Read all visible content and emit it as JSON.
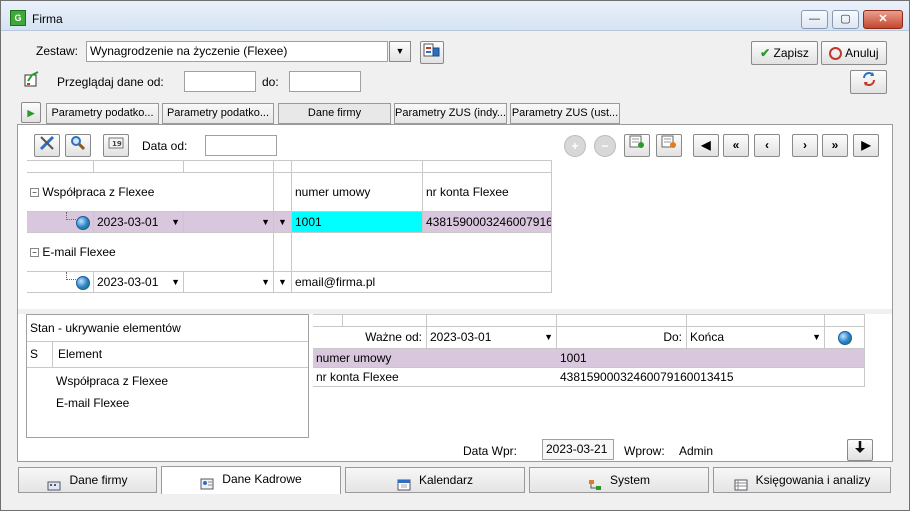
{
  "window": {
    "title": "Firma",
    "min": "—",
    "max": "▢",
    "close": "✕"
  },
  "toolbar": {
    "zestaw_label": "Zestaw:",
    "zestaw_value": "Wynagrodzenie na życzenie (Flexee)",
    "save_label": "Zapisz",
    "cancel_label": "Anuluj",
    "przegladaj_label": "Przeglądaj dane od:",
    "przegladaj_from": "",
    "do_label": "do:",
    "przegladaj_to": ""
  },
  "tabs": [
    "Parametry podatko...",
    "Parametry podatko...",
    "Dane firmy",
    "Parametry ZUS (indy...",
    "Parametry ZUS (ust..."
  ],
  "panel": {
    "data_od_label": "Data od:",
    "data_od_value": "",
    "groups": [
      {
        "name": "Współpraca z Flexee",
        "col_headers": [
          "numer umowy",
          "nr konta Flexee"
        ],
        "date": "2023-03-01",
        "values": [
          "1001",
          "4381590003246007916..."
        ]
      },
      {
        "name": "E-mail Flexee",
        "date": "2023-03-01",
        "values": [
          "email@firma.pl"
        ]
      }
    ],
    "stan": {
      "title": "Stan - ukrywanie elementów",
      "col_s": "S",
      "col_element": "Element",
      "items": [
        "Współpraca z Flexee",
        "E-mail Flexee"
      ]
    },
    "detail": {
      "wazne_od_label": "Ważne od:",
      "wazne_od_value": "2023-03-01",
      "do_label": "Do:",
      "do_value": "Końca",
      "rows": [
        {
          "label": "numer umowy",
          "value": "1001"
        },
        {
          "label": "nr konta Flexee",
          "value": "43815900032460079160013415"
        }
      ]
    },
    "footer": {
      "data_wpr_label": "Data Wpr:",
      "data_wpr_value": "2023-03-21",
      "wprow_label": "Wprow:",
      "wprow_value": "Admin"
    }
  },
  "bottom_tabs": [
    "Dane firmy",
    "Dane Kadrowe",
    "Kalendarz",
    "System",
    "Księgowania i analizy"
  ],
  "colors": {
    "selection": "#d9c7dd",
    "highlight": "#00ffff"
  }
}
